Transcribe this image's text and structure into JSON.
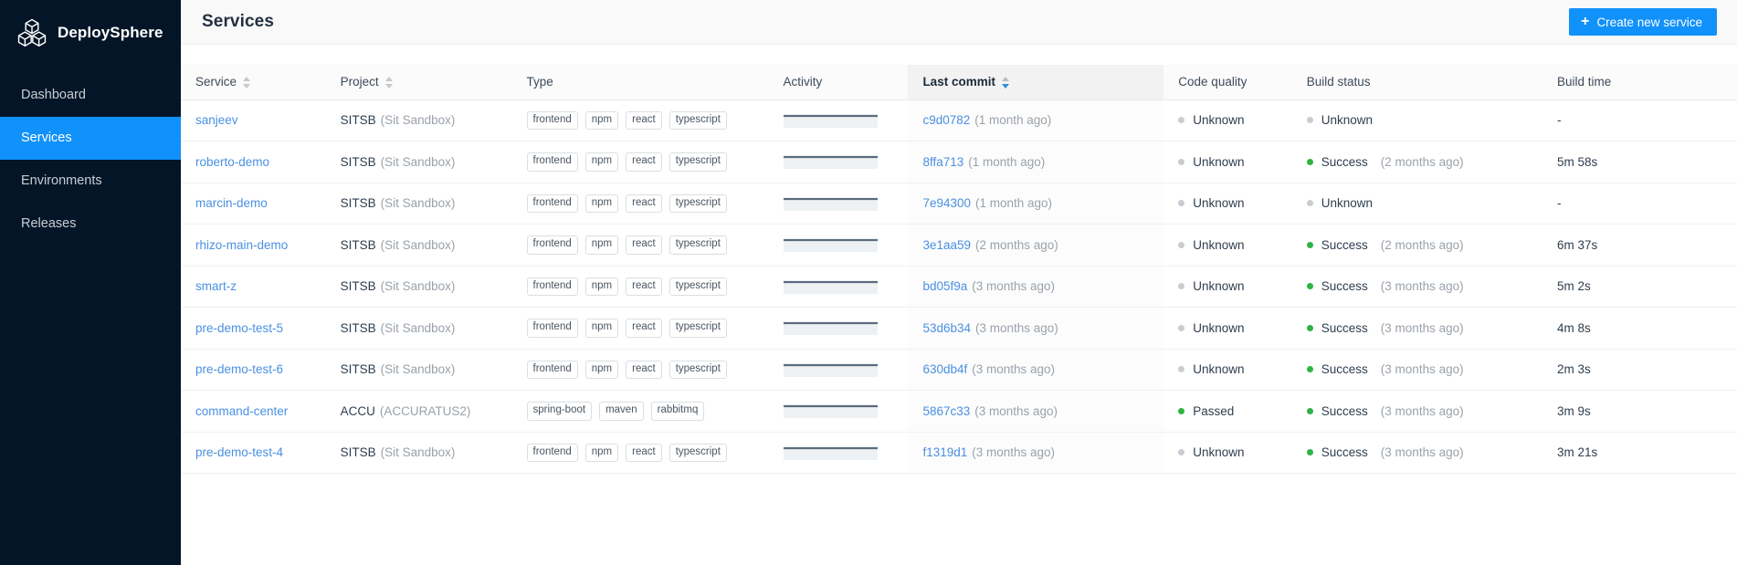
{
  "sidebar": {
    "brand": {
      "name": "DeploySphere",
      "logo_icon": "cubes-logo-icon"
    },
    "items": [
      {
        "label": "Dashboard",
        "active": false
      },
      {
        "label": "Services",
        "active": true
      },
      {
        "label": "Environments",
        "active": false
      },
      {
        "label": "Releases",
        "active": false
      }
    ]
  },
  "header": {
    "title": "Services",
    "create_button": {
      "label": "Create new service",
      "icon": "plus-icon"
    }
  },
  "table": {
    "columns": [
      {
        "label": "Service",
        "sortable": true,
        "sorted": false
      },
      {
        "label": "Project",
        "sortable": true,
        "sorted": false
      },
      {
        "label": "Type",
        "sortable": false,
        "sorted": false
      },
      {
        "label": "Activity",
        "sortable": false,
        "sorted": false
      },
      {
        "label": "Last commit",
        "sortable": true,
        "sorted": true,
        "sort_direction": "desc"
      },
      {
        "label": "Code quality",
        "sortable": false,
        "sorted": false
      },
      {
        "label": "Build status",
        "sortable": false,
        "sorted": false
      },
      {
        "label": "Build time",
        "sortable": false,
        "sorted": false
      }
    ],
    "rows": [
      {
        "service": "sanjeev",
        "project_code": "SITSB",
        "project_name": "(Sit Sandbox)",
        "tags": [
          "frontend",
          "npm",
          "react",
          "typescript"
        ],
        "commit_hash": "c9d0782",
        "commit_age": "(1 month ago)",
        "code_quality": "Unknown",
        "code_quality_state": "unknown",
        "build_status": "Unknown",
        "build_status_age": "",
        "build_status_state": "unknown",
        "build_time": "-"
      },
      {
        "service": "roberto-demo",
        "project_code": "SITSB",
        "project_name": "(Sit Sandbox)",
        "tags": [
          "frontend",
          "npm",
          "react",
          "typescript"
        ],
        "commit_hash": "8ffa713",
        "commit_age": "(1 month ago)",
        "code_quality": "Unknown",
        "code_quality_state": "unknown",
        "build_status": "Success",
        "build_status_age": "(2 months ago)",
        "build_status_state": "success",
        "build_time": "5m 58s"
      },
      {
        "service": "marcin-demo",
        "project_code": "SITSB",
        "project_name": "(Sit Sandbox)",
        "tags": [
          "frontend",
          "npm",
          "react",
          "typescript"
        ],
        "commit_hash": "7e94300",
        "commit_age": "(1 month ago)",
        "code_quality": "Unknown",
        "code_quality_state": "unknown",
        "build_status": "Unknown",
        "build_status_age": "",
        "build_status_state": "unknown",
        "build_time": "-"
      },
      {
        "service": "rhizo-main-demo",
        "project_code": "SITSB",
        "project_name": "(Sit Sandbox)",
        "tags": [
          "frontend",
          "npm",
          "react",
          "typescript"
        ],
        "commit_hash": "3e1aa59",
        "commit_age": "(2 months ago)",
        "code_quality": "Unknown",
        "code_quality_state": "unknown",
        "build_status": "Success",
        "build_status_age": "(2 months ago)",
        "build_status_state": "success",
        "build_time": "6m 37s"
      },
      {
        "service": "smart-z",
        "project_code": "SITSB",
        "project_name": "(Sit Sandbox)",
        "tags": [
          "frontend",
          "npm",
          "react",
          "typescript"
        ],
        "commit_hash": "bd05f9a",
        "commit_age": "(3 months ago)",
        "code_quality": "Unknown",
        "code_quality_state": "unknown",
        "build_status": "Success",
        "build_status_age": "(3 months ago)",
        "build_status_state": "success",
        "build_time": "5m 2s"
      },
      {
        "service": "pre-demo-test-5",
        "project_code": "SITSB",
        "project_name": "(Sit Sandbox)",
        "tags": [
          "frontend",
          "npm",
          "react",
          "typescript"
        ],
        "commit_hash": "53d6b34",
        "commit_age": "(3 months ago)",
        "code_quality": "Unknown",
        "code_quality_state": "unknown",
        "build_status": "Success",
        "build_status_age": "(3 months ago)",
        "build_status_state": "success",
        "build_time": "4m 8s"
      },
      {
        "service": "pre-demo-test-6",
        "project_code": "SITSB",
        "project_name": "(Sit Sandbox)",
        "tags": [
          "frontend",
          "npm",
          "react",
          "typescript"
        ],
        "commit_hash": "630db4f",
        "commit_age": "(3 months ago)",
        "code_quality": "Unknown",
        "code_quality_state": "unknown",
        "build_status": "Success",
        "build_status_age": "(3 months ago)",
        "build_status_state": "success",
        "build_time": "2m 3s"
      },
      {
        "service": "command-center",
        "project_code": "ACCU",
        "project_name": "(ACCURATUS2)",
        "tags": [
          "spring-boot",
          "maven",
          "rabbitmq"
        ],
        "commit_hash": "5867c33",
        "commit_age": "(3 months ago)",
        "code_quality": "Passed",
        "code_quality_state": "success",
        "build_status": "Success",
        "build_status_age": "(3 months ago)",
        "build_status_state": "success",
        "build_time": "3m 9s"
      },
      {
        "service": "pre-demo-test-4",
        "project_code": "SITSB",
        "project_name": "(Sit Sandbox)",
        "tags": [
          "frontend",
          "npm",
          "react",
          "typescript"
        ],
        "commit_hash": "f1319d1",
        "commit_age": "(3 months ago)",
        "code_quality": "Unknown",
        "code_quality_state": "unknown",
        "build_status": "Success",
        "build_status_age": "(3 months ago)",
        "build_status_state": "success",
        "build_time": "3m 21s"
      }
    ]
  },
  "colors": {
    "accent": "#1191fa",
    "sidebar_bg": "#041527",
    "link": "#4a90e2",
    "success": "#2fb344",
    "unknown": "#c9ccd0",
    "spark_line": "#5b6b7f",
    "spark_fill": "#eef1f3"
  }
}
